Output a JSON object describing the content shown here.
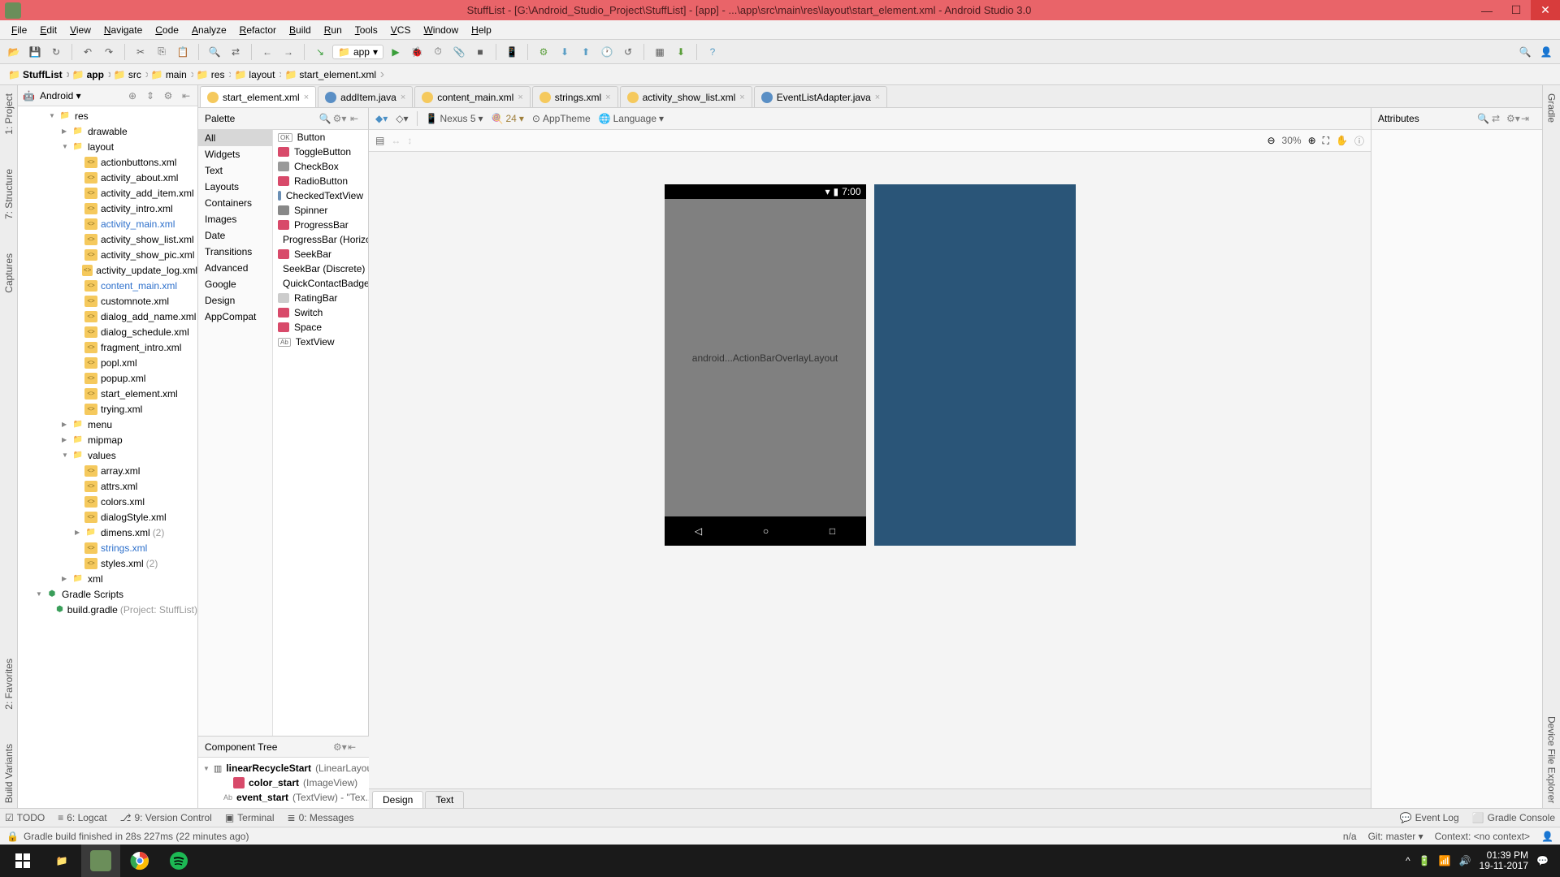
{
  "titlebar": {
    "title": "StuffList - [G:\\Android_Studio_Project\\StuffList] - [app] - ...\\app\\src\\main\\res\\layout\\start_element.xml - Android Studio 3.0"
  },
  "menubar": [
    "File",
    "Edit",
    "View",
    "Navigate",
    "Code",
    "Analyze",
    "Refactor",
    "Build",
    "Run",
    "Tools",
    "VCS",
    "Window",
    "Help"
  ],
  "toolbar": {
    "config": "app"
  },
  "breadcrumb": [
    "StuffList",
    "app",
    "src",
    "main",
    "res",
    "layout",
    "start_element.xml"
  ],
  "project": {
    "view": "Android",
    "tree": [
      {
        "d": 2,
        "arrow": "open",
        "icon": "folder",
        "label": "res"
      },
      {
        "d": 3,
        "arrow": "closed",
        "icon": "folder",
        "label": "drawable"
      },
      {
        "d": 3,
        "arrow": "open",
        "icon": "folder",
        "label": "layout"
      },
      {
        "d": 4,
        "arrow": "none",
        "icon": "xml",
        "label": "actionbuttons.xml"
      },
      {
        "d": 4,
        "arrow": "none",
        "icon": "xml",
        "label": "activity_about.xml"
      },
      {
        "d": 4,
        "arrow": "none",
        "icon": "xml",
        "label": "activity_add_item.xml"
      },
      {
        "d": 4,
        "arrow": "none",
        "icon": "xml",
        "label": "activity_intro.xml"
      },
      {
        "d": 4,
        "arrow": "none",
        "icon": "xml",
        "label": "activity_main.xml",
        "link": true
      },
      {
        "d": 4,
        "arrow": "none",
        "icon": "xml",
        "label": "activity_show_list.xml"
      },
      {
        "d": 4,
        "arrow": "none",
        "icon": "xml",
        "label": "activity_show_pic.xml"
      },
      {
        "d": 4,
        "arrow": "none",
        "icon": "xml",
        "label": "activity_update_log.xml"
      },
      {
        "d": 4,
        "arrow": "none",
        "icon": "xml",
        "label": "content_main.xml",
        "link": true
      },
      {
        "d": 4,
        "arrow": "none",
        "icon": "xml",
        "label": "customnote.xml"
      },
      {
        "d": 4,
        "arrow": "none",
        "icon": "xml",
        "label": "dialog_add_name.xml"
      },
      {
        "d": 4,
        "arrow": "none",
        "icon": "xml",
        "label": "dialog_schedule.xml"
      },
      {
        "d": 4,
        "arrow": "none",
        "icon": "xml",
        "label": "fragment_intro.xml"
      },
      {
        "d": 4,
        "arrow": "none",
        "icon": "xml",
        "label": "popl.xml"
      },
      {
        "d": 4,
        "arrow": "none",
        "icon": "xml",
        "label": "popup.xml"
      },
      {
        "d": 4,
        "arrow": "none",
        "icon": "xml",
        "label": "start_element.xml"
      },
      {
        "d": 4,
        "arrow": "none",
        "icon": "xml",
        "label": "trying.xml"
      },
      {
        "d": 3,
        "arrow": "closed",
        "icon": "folder",
        "label": "menu"
      },
      {
        "d": 3,
        "arrow": "closed",
        "icon": "folder",
        "label": "mipmap"
      },
      {
        "d": 3,
        "arrow": "open",
        "icon": "folder",
        "label": "values"
      },
      {
        "d": 4,
        "arrow": "none",
        "icon": "xml",
        "label": "array.xml"
      },
      {
        "d": 4,
        "arrow": "none",
        "icon": "xml",
        "label": "attrs.xml"
      },
      {
        "d": 4,
        "arrow": "none",
        "icon": "xml",
        "label": "colors.xml"
      },
      {
        "d": 4,
        "arrow": "none",
        "icon": "xml",
        "label": "dialogStyle.xml"
      },
      {
        "d": 4,
        "arrow": "closed",
        "icon": "folder",
        "label": "dimens.xml",
        "suffix": "(2)"
      },
      {
        "d": 4,
        "arrow": "none",
        "icon": "xml",
        "label": "strings.xml",
        "link": true
      },
      {
        "d": 4,
        "arrow": "none",
        "icon": "xml",
        "label": "styles.xml",
        "suffix": "(2)"
      },
      {
        "d": 3,
        "arrow": "closed",
        "icon": "folder",
        "label": "xml"
      },
      {
        "d": 1,
        "arrow": "open",
        "icon": "gradle",
        "label": "Gradle Scripts"
      },
      {
        "d": 2,
        "arrow": "none",
        "icon": "gradle",
        "label": "build.gradle",
        "suffix": "(Project: StuffList)"
      }
    ]
  },
  "editor_tabs": [
    {
      "label": "start_element.xml",
      "type": "xml",
      "active": true
    },
    {
      "label": "addItem.java",
      "type": "java"
    },
    {
      "label": "content_main.xml",
      "type": "xml"
    },
    {
      "label": "strings.xml",
      "type": "xml"
    },
    {
      "label": "activity_show_list.xml",
      "type": "xml"
    },
    {
      "label": "EventListAdapter.java",
      "type": "java"
    }
  ],
  "palette": {
    "title": "Palette",
    "categories": [
      "All",
      "Widgets",
      "Text",
      "Layouts",
      "Containers",
      "Images",
      "Date",
      "Transitions",
      "Advanced",
      "Google",
      "Design",
      "AppCompat"
    ],
    "selected_category": "All",
    "items": [
      {
        "icon": "#888",
        "label": "Button",
        "badge": "OK"
      },
      {
        "icon": "#d84a6a",
        "label": "ToggleButton"
      },
      {
        "icon": "#999",
        "label": "CheckBox"
      },
      {
        "icon": "#d84a6a",
        "label": "RadioButton"
      },
      {
        "icon": "#6a8fb5",
        "label": "CheckedTextView"
      },
      {
        "icon": "#888",
        "label": "Spinner"
      },
      {
        "icon": "#d84a6a",
        "label": "ProgressBar"
      },
      {
        "icon": "#d84a6a",
        "label": "ProgressBar (Horizontal)"
      },
      {
        "icon": "#d84a6a",
        "label": "SeekBar"
      },
      {
        "icon": "#d84a6a",
        "label": "SeekBar (Discrete)"
      },
      {
        "icon": "#d84a6a",
        "label": "QuickContactBadge"
      },
      {
        "icon": "#ccc",
        "label": "RatingBar"
      },
      {
        "icon": "#d84a6a",
        "label": "Switch"
      },
      {
        "icon": "#d84a6a",
        "label": "Space"
      },
      {
        "icon": "#888",
        "label": "TextView",
        "badge": "Ab"
      }
    ]
  },
  "component_tree": {
    "title": "Component Tree",
    "rows": [
      {
        "d": 0,
        "arrow": "open",
        "name": "linearRecycleStart",
        "type": "(LinearLayout)"
      },
      {
        "d": 1,
        "arrow": "none",
        "name": "color_start",
        "type": "(ImageView)",
        "icon": "#d84a6a"
      },
      {
        "d": 1,
        "arrow": "none",
        "name": "event_start",
        "type": "(TextView)",
        "extra": " - \"Tex...",
        "badge": "Ab"
      }
    ]
  },
  "design_toolbar": {
    "device": "Nexus 5",
    "api": "24",
    "theme": "AppTheme",
    "language": "Language"
  },
  "design_secondary": {
    "zoom": "30%"
  },
  "phone": {
    "time": "7:00",
    "overlay": "android...ActionBarOverlayLayout"
  },
  "attributes": {
    "title": "Attributes"
  },
  "design_tabs": {
    "design": "Design",
    "text": "Text"
  },
  "bottom_tools": {
    "todo": "TODO",
    "logcat": "6: Logcat",
    "vcs": "9: Version Control",
    "terminal": "Terminal",
    "messages": "0: Messages",
    "eventlog": "Event Log",
    "gradle_console": "Gradle Console"
  },
  "statusbar": {
    "msg": "Gradle build finished in 28s 227ms (22 minutes ago)",
    "na": "n/a",
    "git": "Git: master",
    "context": "Context: <no context>"
  },
  "left_vtabs": [
    "1: Project",
    "7: Structure",
    "Captures"
  ],
  "left_vtabs2": [
    "2: Favorites",
    "Build Variants"
  ],
  "right_vtabs": [
    "Gradle",
    "Device File Explorer"
  ],
  "taskbar": {
    "time": "01:39 PM",
    "date": "19-11-2017"
  }
}
